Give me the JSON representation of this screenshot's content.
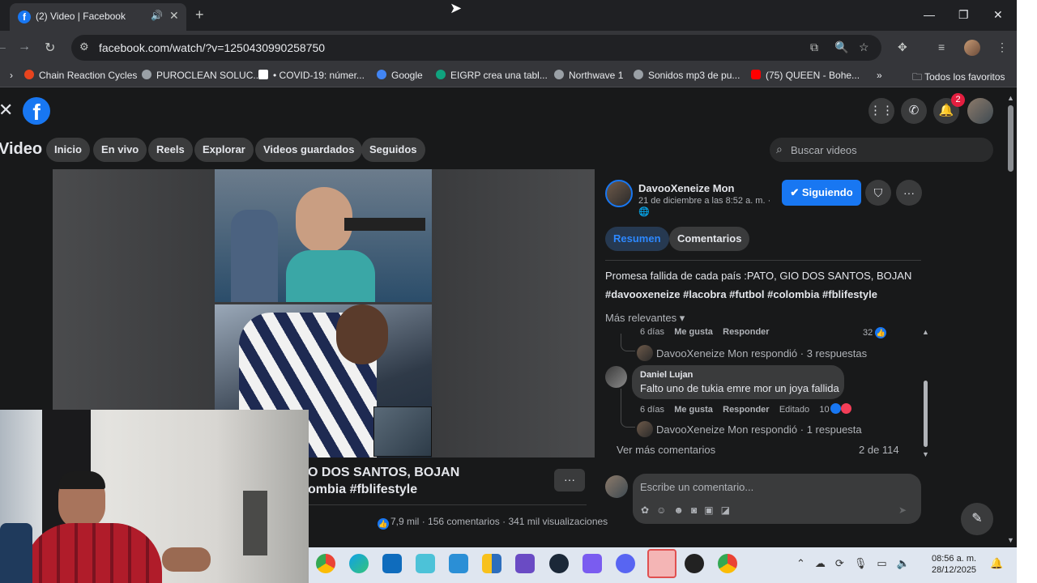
{
  "browser": {
    "tab_title": "(2) Video | Facebook",
    "tab_favicon": "f",
    "speaker_icon": "speaker-icon",
    "close_tab": "✕",
    "new_tab": "+",
    "url": "facebook.com/watch/?v=1250430990258750",
    "bookmarks": [
      {
        "label": "Chain Reaction Cycles",
        "color": "#e8441e"
      },
      {
        "label": "PUROCLEAN SOLUC...",
        "color": "#9aa0a6"
      },
      {
        "label": "• COVID-19: númer...",
        "color": "#ffffff"
      },
      {
        "label": "Google",
        "color": "#4285f4"
      },
      {
        "label": "EIGRP crea una tabl...",
        "color": "#10a37f"
      },
      {
        "label": "Northwave 1",
        "color": "#9aa0a6"
      },
      {
        "label": "Sonidos mp3 de pu...",
        "color": "#9aa0a6"
      },
      {
        "label": "(75) QUEEN - Bohe...",
        "color": "#ff0000"
      }
    ],
    "more_bookmarks": "»",
    "all_favorites": "Todos los favoritos"
  },
  "fb": {
    "logo": "f",
    "notif_count": "2",
    "page_title": "Video",
    "nav": [
      "Inicio",
      "En vivo",
      "Reels",
      "Explorar",
      "Videos guardados",
      "Seguidos"
    ],
    "search_placeholder": "Buscar videos"
  },
  "video": {
    "caption_line1": "O DOS SANTOS, BOJAN",
    "caption_line2": "ombia #fblifestyle",
    "more": "···",
    "likes": "7,9 mil",
    "comments": "156 comentarios",
    "views": "341 mil visualizaciones",
    "stats_sep": "·"
  },
  "post": {
    "author": "DavooXeneize Mon",
    "date": "21 de diciembre a las 8:52 a. m. ·",
    "follow_label": "Siguiendo",
    "tab_summary": "Resumen",
    "tab_comments": "Comentarios",
    "text": "Promesa fallida de cada país :PATO, GIO DOS SANTOS, BOJAN",
    "tags": "#davooxeneize #lacobra #futbol #colombia #fblifestyle",
    "sort": "Más relevantes",
    "c1_meta": {
      "time": "6 días",
      "like": "Me gusta",
      "reply": "Responder",
      "count": "32"
    },
    "c1_reply": "DavooXeneize Mon respondió · 3 respuestas",
    "c2_author": "Daniel Lujan",
    "c2_text": "Falto uno de tukia emre mor un joya fallida",
    "c2_meta": {
      "time": "6 días",
      "like": "Me gusta",
      "reply": "Responder",
      "edited": "Editado",
      "count": "10"
    },
    "c2_reply": "DavooXeneize Mon respondió · 1 respuesta",
    "more_comments": "Ver más comentarios",
    "count": "2 de 114",
    "write_placeholder": "Escribe un comentario..."
  },
  "taskbar": {
    "time": "08:56 a. m.",
    "date": "28/12/2025"
  }
}
